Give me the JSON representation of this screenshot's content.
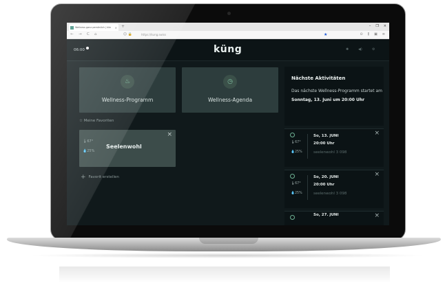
{
  "browser": {
    "tab_title": "Wellness ganz persönlich | kün",
    "tab_close": "×",
    "new_tab": "+",
    "url": "https://kung.swiss",
    "nav": {
      "back": "←",
      "forward": "→",
      "reload": "C",
      "home": "⌂"
    },
    "window_controls": [
      "–",
      "❐",
      "×"
    ],
    "toolbar_icons": [
      "⊙",
      "⫼",
      "▣",
      "≡"
    ]
  },
  "app": {
    "time": "06:00",
    "logo": "küng",
    "program_cards": [
      {
        "label": "Wellness-Programm",
        "icon": "steam-icon",
        "glyph": "♨"
      },
      {
        "label": "Wellness-Agenda",
        "icon": "clock-icon",
        "glyph": "◷"
      }
    ],
    "favorites": {
      "header": "Meine Favoriten",
      "star": "☆",
      "card": {
        "title": "Seelenwohl",
        "temp": "67°",
        "humidity": "25%",
        "close": "×"
      },
      "create_label": "Favorit erstellen",
      "create_plus": "+"
    },
    "side_panel": {
      "title": "Nächste Aktivitäten",
      "text_before": "Das nächste Wellness-Programm startet am ",
      "text_bold": "Sonntag, 13. Juni um 20:00 Uhr",
      "events": [
        {
          "date": "So, 13. JUNI",
          "time": "20:00 Uhr",
          "name": "seelenwohl 3 098",
          "temp": "67°",
          "humidity": "25%",
          "close": "×"
        },
        {
          "date": "So, 20. JUNI",
          "time": "20:00 Uhr",
          "name": "seelenwohl 3 098",
          "temp": "67°",
          "humidity": "25%",
          "close": "×"
        },
        {
          "date": "So, 27. JUNI",
          "time": "",
          "name": "",
          "temp": "",
          "humidity": "",
          "close": "×"
        }
      ]
    }
  },
  "colors": {
    "background": "#10191b",
    "card": "#2d3d3d",
    "accent_green": "#6fb394",
    "text_light": "#e6eceb"
  }
}
